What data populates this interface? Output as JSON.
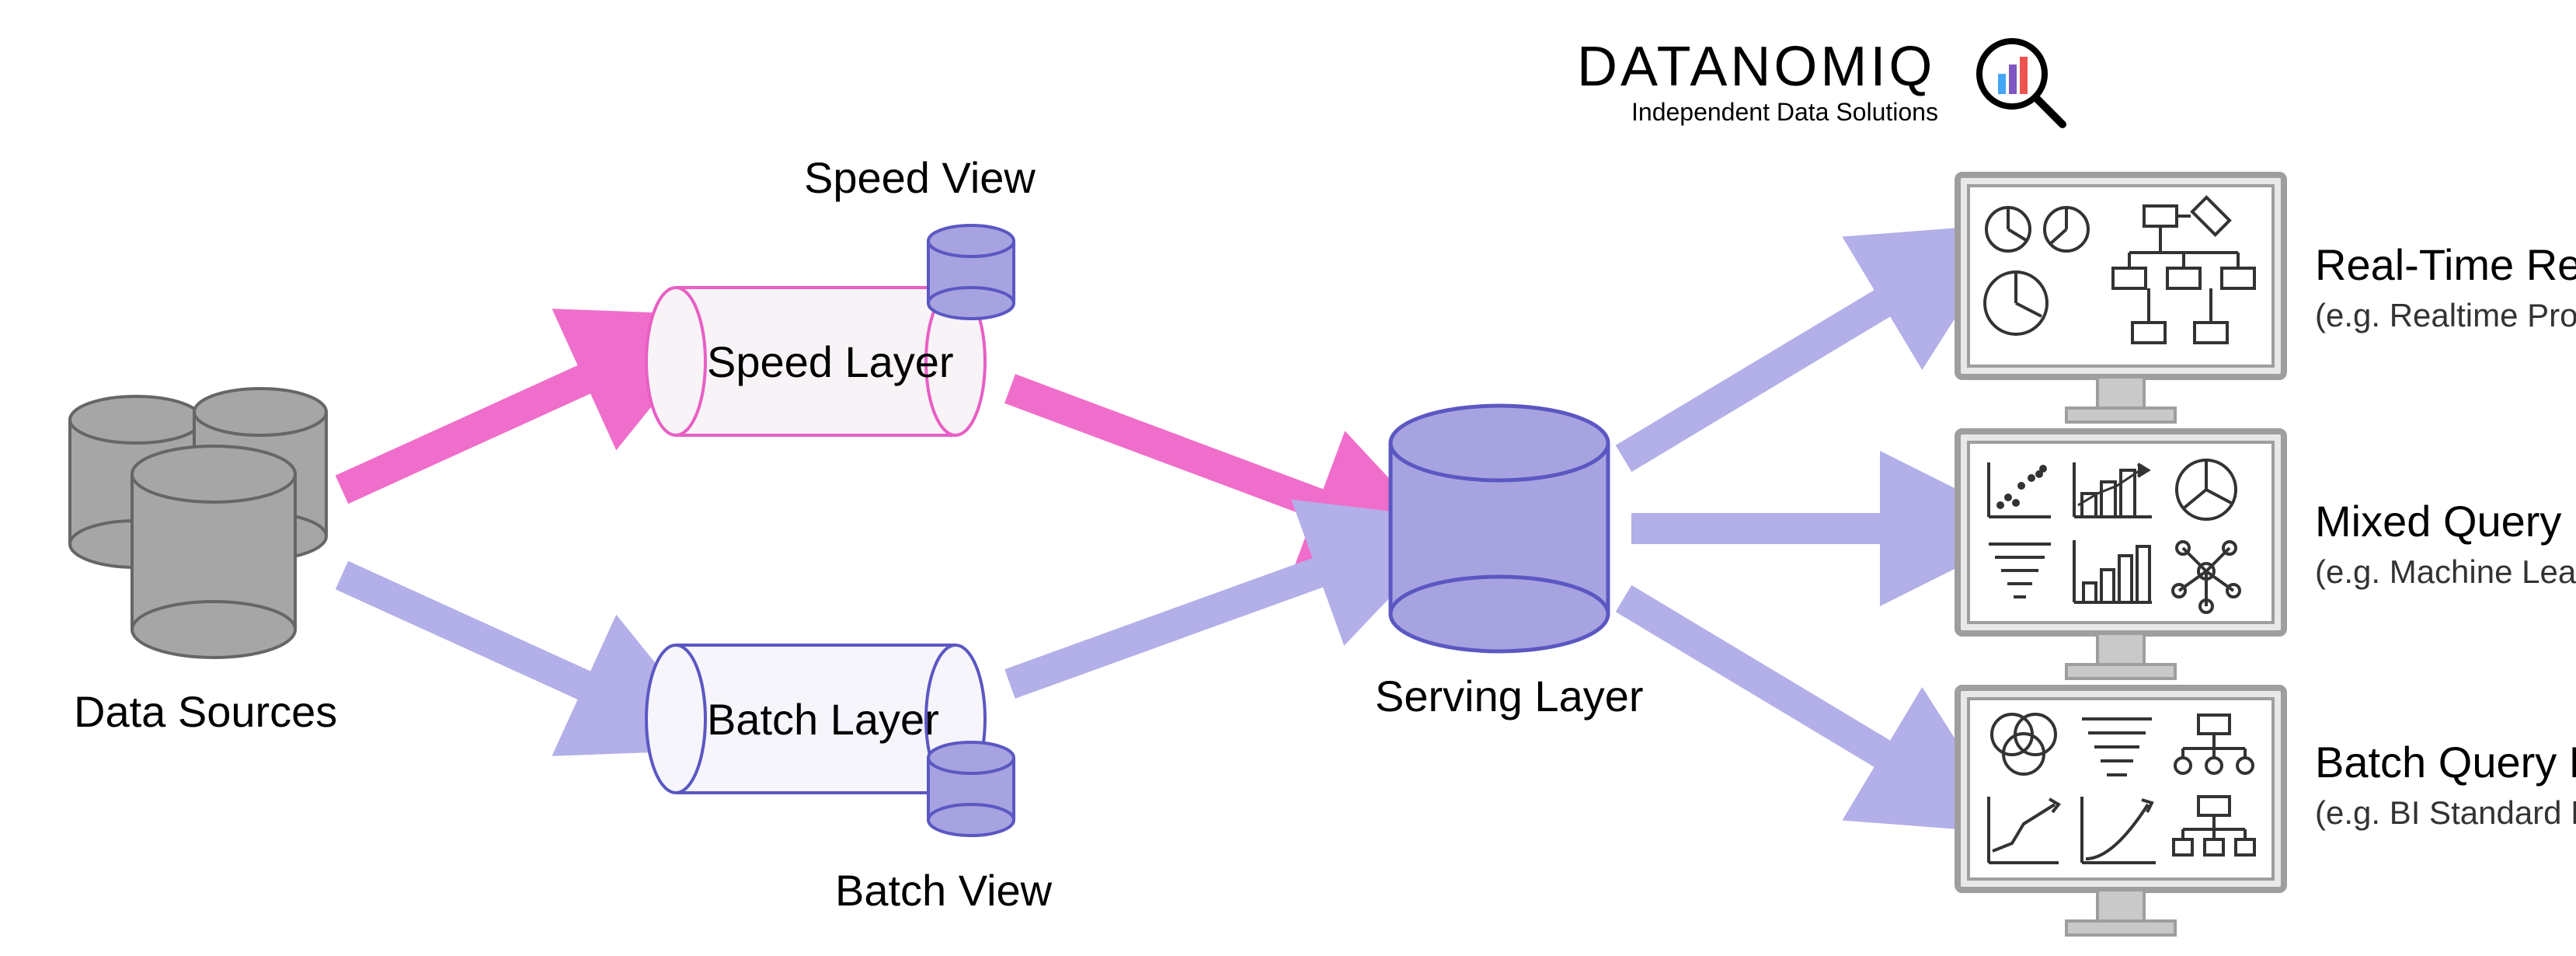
{
  "brand": {
    "name": "DATANOMIQ",
    "tagline": "Independent Data Solutions"
  },
  "nodes": {
    "data_sources": "Data Sources",
    "speed_layer": "Speed Layer",
    "speed_view": "Speed View",
    "batch_layer": "Batch Layer",
    "batch_view": "Batch View",
    "serving_layer": "Serving Layer"
  },
  "outputs": {
    "realtime": {
      "title": "Real-Time Report",
      "subtitle": "(e.g. Realtime Process Mining)"
    },
    "mixed": {
      "title": "Mixed Query Report",
      "subtitle": "(e.g. Machine Learning Training)"
    },
    "batch": {
      "title": "Batch Query Report",
      "subtitle": "(e.g. BI Standard Reporting)"
    }
  },
  "colors": {
    "gray_fill": "#a6a6a6",
    "gray_stroke": "#666666",
    "purple_fill": "#a7a3e0",
    "purple_stroke": "#5b57c2",
    "pink_stroke": "#e85fc4",
    "pink_fill": "#f7d6ef",
    "arrow_purple": "#b3afe8",
    "arrow_pink": "#f06ecb",
    "monitor_frame": "#9e9e9e",
    "monitor_inner": "#e8e8e8",
    "icon_stroke": "#333333"
  }
}
